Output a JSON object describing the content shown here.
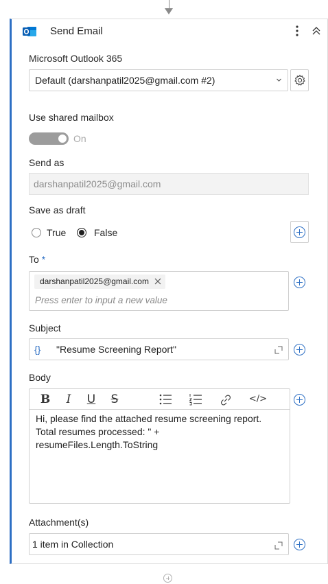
{
  "activity": {
    "title": "Send Email",
    "icon": "outlook-icon",
    "accent": "#2d6fc4"
  },
  "account": {
    "label": "Microsoft Outlook 365",
    "selected": "Default (darshanpatil2025@gmail.com #2)"
  },
  "shared_mailbox": {
    "label": "Use shared mailbox",
    "toggle_text": "On"
  },
  "send_as": {
    "label": "Send as",
    "value": "darshanpatil2025@gmail.com"
  },
  "save_as_draft": {
    "label": "Save as draft",
    "options": [
      "True",
      "False"
    ],
    "selected": "False"
  },
  "to": {
    "label": "To",
    "required_mark": "*",
    "chips": [
      "darshanpatil2025@gmail.com"
    ],
    "placeholder": "Press enter to input a new value"
  },
  "subject": {
    "label": "Subject",
    "expression_icon": "{}",
    "value": "\"Resume Screening Report\""
  },
  "body": {
    "label": "Body",
    "toolbar": [
      "B",
      "I",
      "U",
      "S",
      "bulleted-list",
      "numbered-list",
      "link",
      "</>"
    ],
    "text": "Hi, please find the attached resume screening report. Total resumes processed: \" + resumeFiles.Length.ToString"
  },
  "attachments": {
    "label": "Attachment(s)",
    "value": "1 item in Collection"
  }
}
